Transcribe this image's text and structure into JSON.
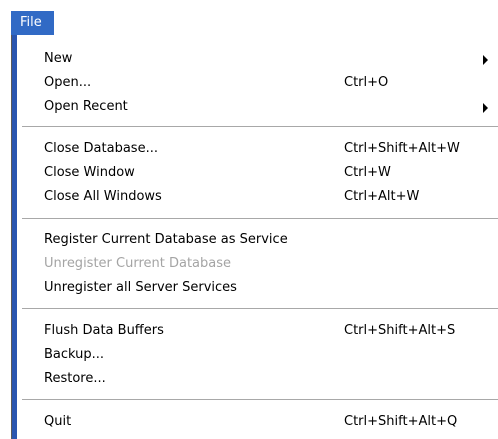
{
  "menubar": {
    "file_label": "File"
  },
  "menu": {
    "new": {
      "label": "New"
    },
    "open": {
      "label": "Open...",
      "shortcut": "Ctrl+O"
    },
    "open_recent": {
      "label": "Open Recent"
    },
    "close_database": {
      "label": "Close Database...",
      "shortcut": "Ctrl+Shift+Alt+W"
    },
    "close_window": {
      "label": "Close Window",
      "shortcut": "Ctrl+W"
    },
    "close_all_windows": {
      "label": "Close All Windows",
      "shortcut": "Ctrl+Alt+W"
    },
    "register_service": {
      "label": "Register Current Database as Service"
    },
    "unregister_current": {
      "label": "Unregister Current Database",
      "disabled": true
    },
    "unregister_all": {
      "label": "Unregister all Server Services"
    },
    "flush_buffers": {
      "label": "Flush Data Buffers",
      "shortcut": "Ctrl+Shift+Alt+S"
    },
    "backup": {
      "label": "Backup..."
    },
    "restore": {
      "label": "Restore..."
    },
    "quit": {
      "label": "Quit",
      "shortcut": "Ctrl+Shift+Alt+Q"
    }
  },
  "colors": {
    "selection": "#316ac5",
    "accent_bar": "#2a56b0",
    "disabled_text": "#a4a4a4"
  }
}
